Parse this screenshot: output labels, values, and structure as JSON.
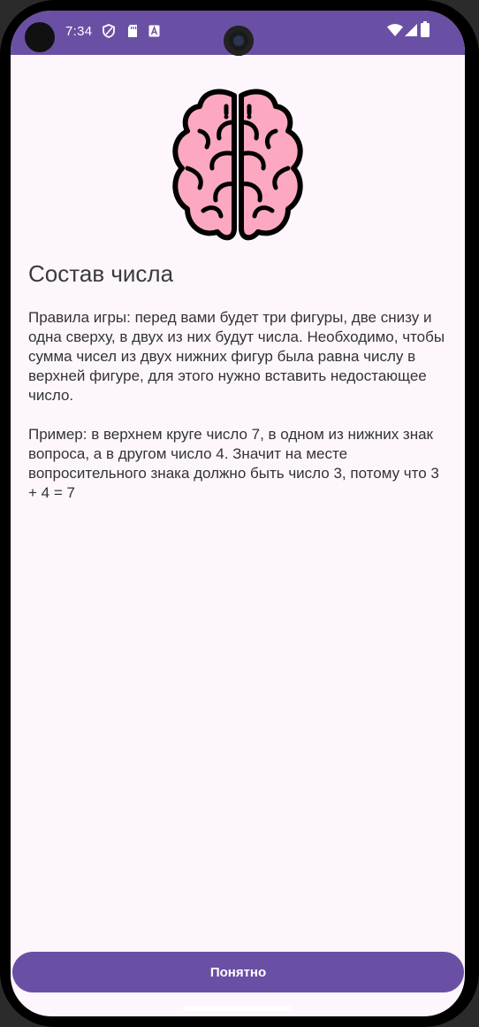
{
  "status_bar": {
    "time": "7:34",
    "left_icons": [
      "shield-icon",
      "sd-card-icon",
      "font-a-icon"
    ],
    "right_icons": [
      "wifi-icon",
      "signal-icon",
      "battery-icon"
    ],
    "color": "#6a50a4"
  },
  "main": {
    "image": "brain-icon",
    "title": "Состав числа",
    "rules_text": "Правила игры: перед вами будет три фигуры, две снизу и одна сверху, в двух из них будут числа. Необходимо, чтобы сумма чисел из двух нижних фигур была равна числу в верхней фигуре, для этого нужно вставить недостающее число.",
    "example_text": "Пример: в верхнем круге число 7, в одном из нижних знак вопроса, а в другом число 4. Значит на месте вопросительного знака должно быть число 3, потому что 3 + 4 = 7"
  },
  "actions": {
    "ok_label": "Понятно",
    "accent": "#6a50a4"
  }
}
